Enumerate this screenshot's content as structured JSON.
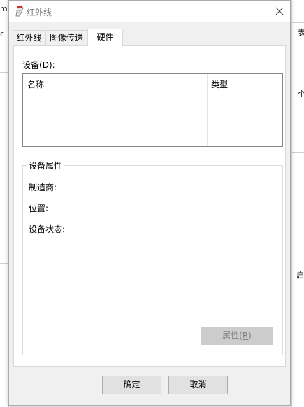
{
  "window": {
    "title": "红外线"
  },
  "tabs": [
    {
      "label": "红外线",
      "active": false
    },
    {
      "label": "图像传送",
      "active": false
    },
    {
      "label": "硬件",
      "active": true
    }
  ],
  "devices": {
    "label": "设备(",
    "label_key": "D",
    "label_end": "):",
    "columns": [
      "名称",
      "类型"
    ],
    "rows": []
  },
  "device_properties": {
    "group_title": "设备属性",
    "manufacturer_label": "制造商:",
    "location_label": "位置:",
    "status_label": "设备状态:",
    "properties_button": "属性(",
    "properties_key": "R",
    "properties_end": ")",
    "properties_enabled": false
  },
  "buttons": {
    "ok": "确定",
    "cancel": "取消"
  },
  "background": {
    "left_fragments": [
      "m",
      "c"
    ],
    "right_fragments": [
      "表",
      "个",
      "启"
    ]
  }
}
